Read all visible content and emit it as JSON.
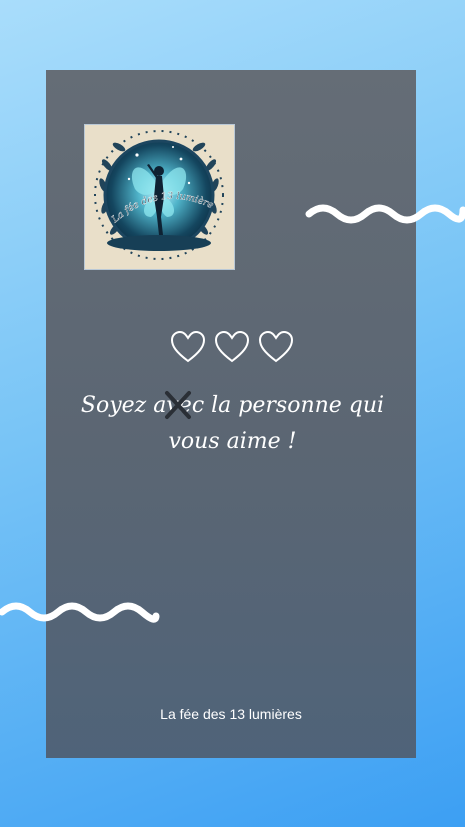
{
  "logo": {
    "text": "La fée des 13 lumières",
    "icon": "fairy-silhouette-emblem"
  },
  "hearts": {
    "count": 3,
    "icon": "heart-outline-icon",
    "color": "#ffffff"
  },
  "quote": {
    "before_strike": "Soyez a",
    "struck_letters": "ve",
    "after_strike": "c la personne qui",
    "line2": "vous aime !"
  },
  "footer": {
    "signature": "La fée des 13 lumières"
  },
  "colors": {
    "background_top": "#a9ddfb",
    "background_bottom": "#3c9ff3",
    "card": "#5f6873",
    "wave": "#ffffff",
    "strike_mark": "#2a2f36"
  }
}
